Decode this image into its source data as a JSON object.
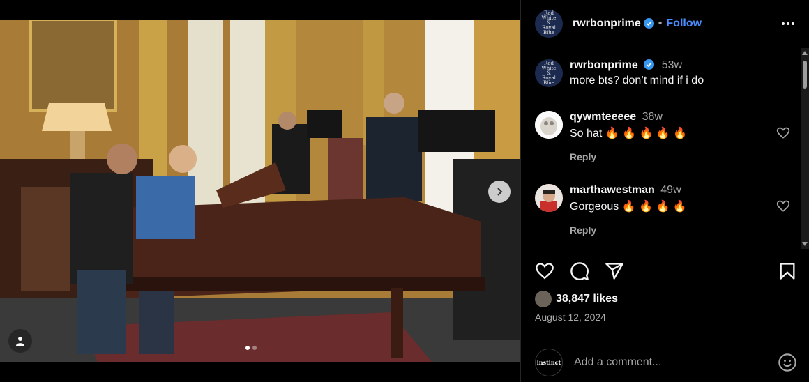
{
  "post": {
    "username": "rwrbonprime",
    "follow_label": "Follow",
    "separator": "•",
    "avatar_text": "Red White & Royal Blue"
  },
  "caption": {
    "username": "rwrbonprime",
    "time": "53w",
    "text": "more bts? don’t mind if i do"
  },
  "comments": [
    {
      "username": "qywmteeeee",
      "time": "38w",
      "text": "So hat 🔥 🔥 🔥 🔥 🔥",
      "reply_label": "Reply"
    },
    {
      "username": "marthawestman",
      "time": "49w",
      "text": "Gorgeous 🔥 🔥 🔥 🔥",
      "reply_label": "Reply"
    }
  ],
  "likes": "38,847 likes",
  "date": "August 12, 2024",
  "add_comment": {
    "placeholder": "Add a comment...",
    "avatar_text": "instinct"
  },
  "colors": {
    "accent": "#4a8cff",
    "verified": "#3897f0",
    "muted": "#a8a8a8"
  },
  "icons": {
    "like": "heart-icon",
    "comment": "comment-icon",
    "share": "paper-plane-icon",
    "save": "bookmark-icon",
    "more": "more-options-icon",
    "next": "chevron-right-icon",
    "tag": "user-tag-icon",
    "emoji": "emoji-icon"
  },
  "carousel": {
    "slide_count": 2,
    "active_slide": 1
  }
}
